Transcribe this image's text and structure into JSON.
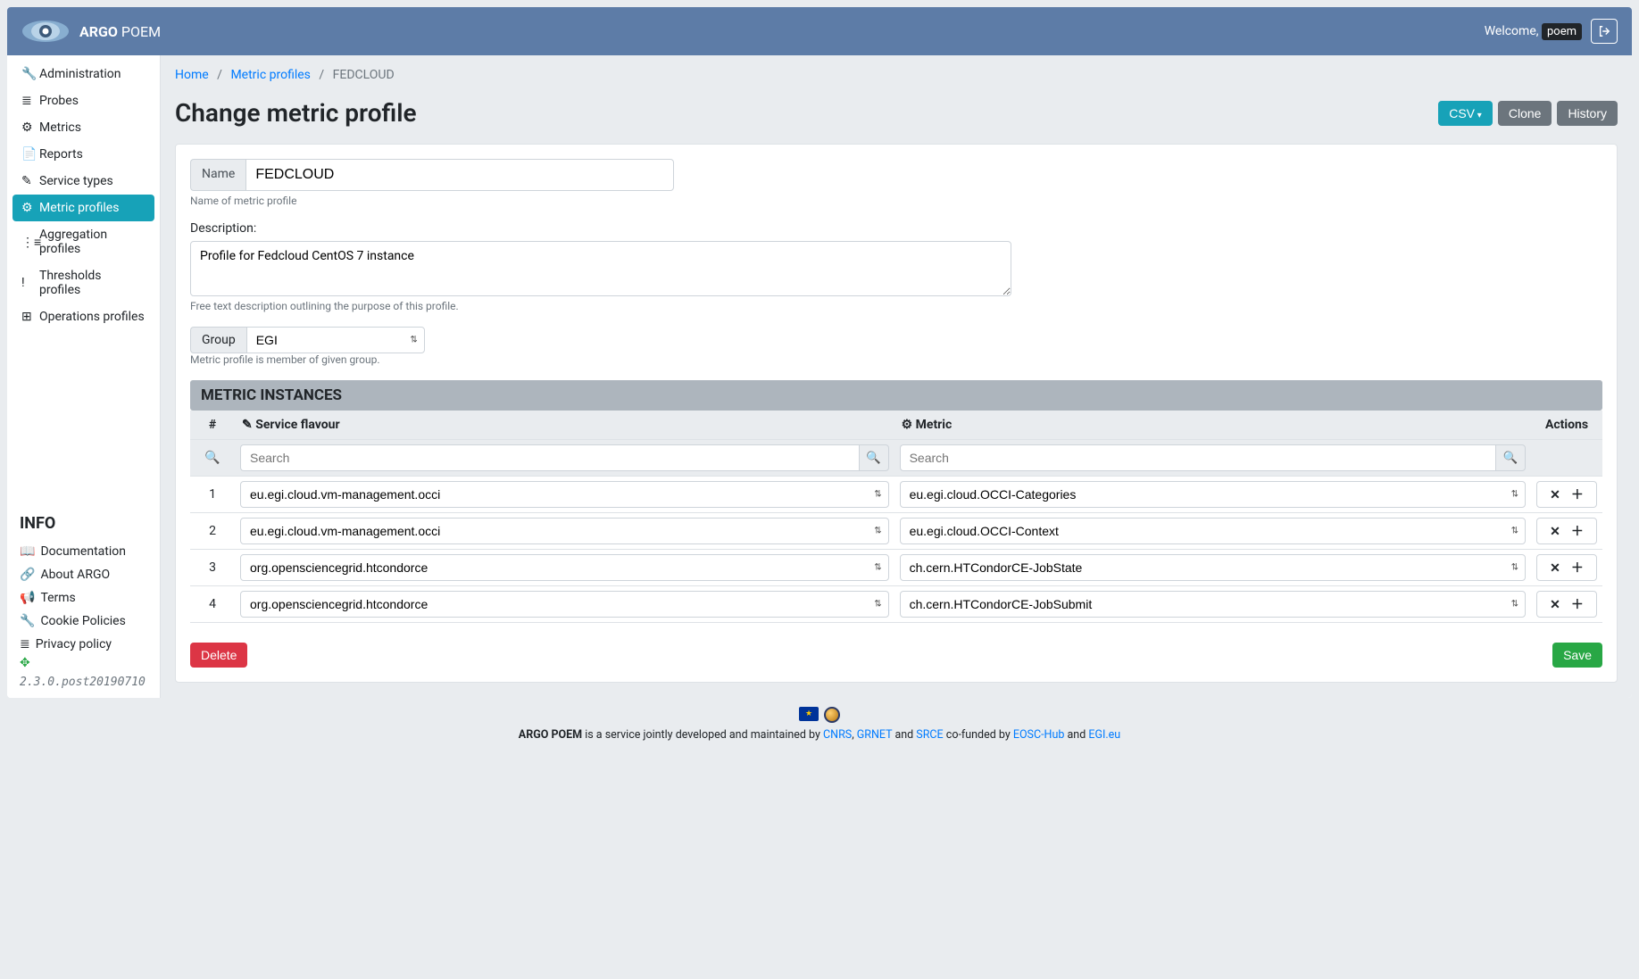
{
  "brand": {
    "strong": "ARGO",
    "light": "POEM"
  },
  "welcome_prefix": "Welcome,",
  "user": "poem",
  "sidebar": {
    "items": [
      {
        "label": "Administration"
      },
      {
        "label": "Probes"
      },
      {
        "label": "Metrics"
      },
      {
        "label": "Reports"
      },
      {
        "label": "Service types"
      },
      {
        "label": "Metric profiles"
      },
      {
        "label": "Aggregation profiles"
      },
      {
        "label": "Thresholds profiles"
      },
      {
        "label": "Operations profiles"
      }
    ],
    "info_title": "INFO",
    "info_items": [
      {
        "label": "Documentation"
      },
      {
        "label": "About ARGO"
      },
      {
        "label": "Terms"
      },
      {
        "label": "Cookie Policies"
      },
      {
        "label": "Privacy policy"
      }
    ],
    "version": "2.3.0.post20190710"
  },
  "breadcrumb": {
    "home": "Home",
    "parent": "Metric profiles",
    "current": "FEDCLOUD"
  },
  "page_title": "Change metric profile",
  "actions": {
    "csv": "CSV",
    "clone": "Clone",
    "history": "History"
  },
  "form": {
    "name_label": "Name",
    "name_value": "FEDCLOUD",
    "name_help": "Name of metric profile",
    "desc_label": "Description:",
    "desc_value": "Profile for Fedcloud CentOS 7 instance",
    "desc_help": "Free text description outlining the purpose of this profile.",
    "group_label": "Group",
    "group_value": "EGI",
    "group_help": "Metric profile is member of given group."
  },
  "table": {
    "section_title": "METRIC INSTANCES",
    "col_num": "#",
    "col_service": "Service flavour",
    "col_metric": "Metric",
    "col_actions": "Actions",
    "search_placeholder": "Search",
    "rows": [
      {
        "n": "1",
        "service": "eu.egi.cloud.vm-management.occi",
        "metric": "eu.egi.cloud.OCCI-Categories"
      },
      {
        "n": "2",
        "service": "eu.egi.cloud.vm-management.occi",
        "metric": "eu.egi.cloud.OCCI-Context"
      },
      {
        "n": "3",
        "service": "org.opensciencegrid.htcondorce",
        "metric": "ch.cern.HTCondorCE-JobState"
      },
      {
        "n": "4",
        "service": "org.opensciencegrid.htcondorce",
        "metric": "ch.cern.HTCondorCE-JobSubmit"
      }
    ]
  },
  "buttons": {
    "delete": "Delete",
    "save": "Save"
  },
  "footer": {
    "text_pre": "ARGO POEM",
    "text_mid1": " is a service jointly developed and maintained by ",
    "cnrs": "CNRS",
    "grnet": "GRNET",
    "and": " and ",
    "srce": "SRCE",
    "text_mid2": " co-funded by ",
    "eosc": "EOSC-Hub",
    "egi": "EGI.eu"
  }
}
